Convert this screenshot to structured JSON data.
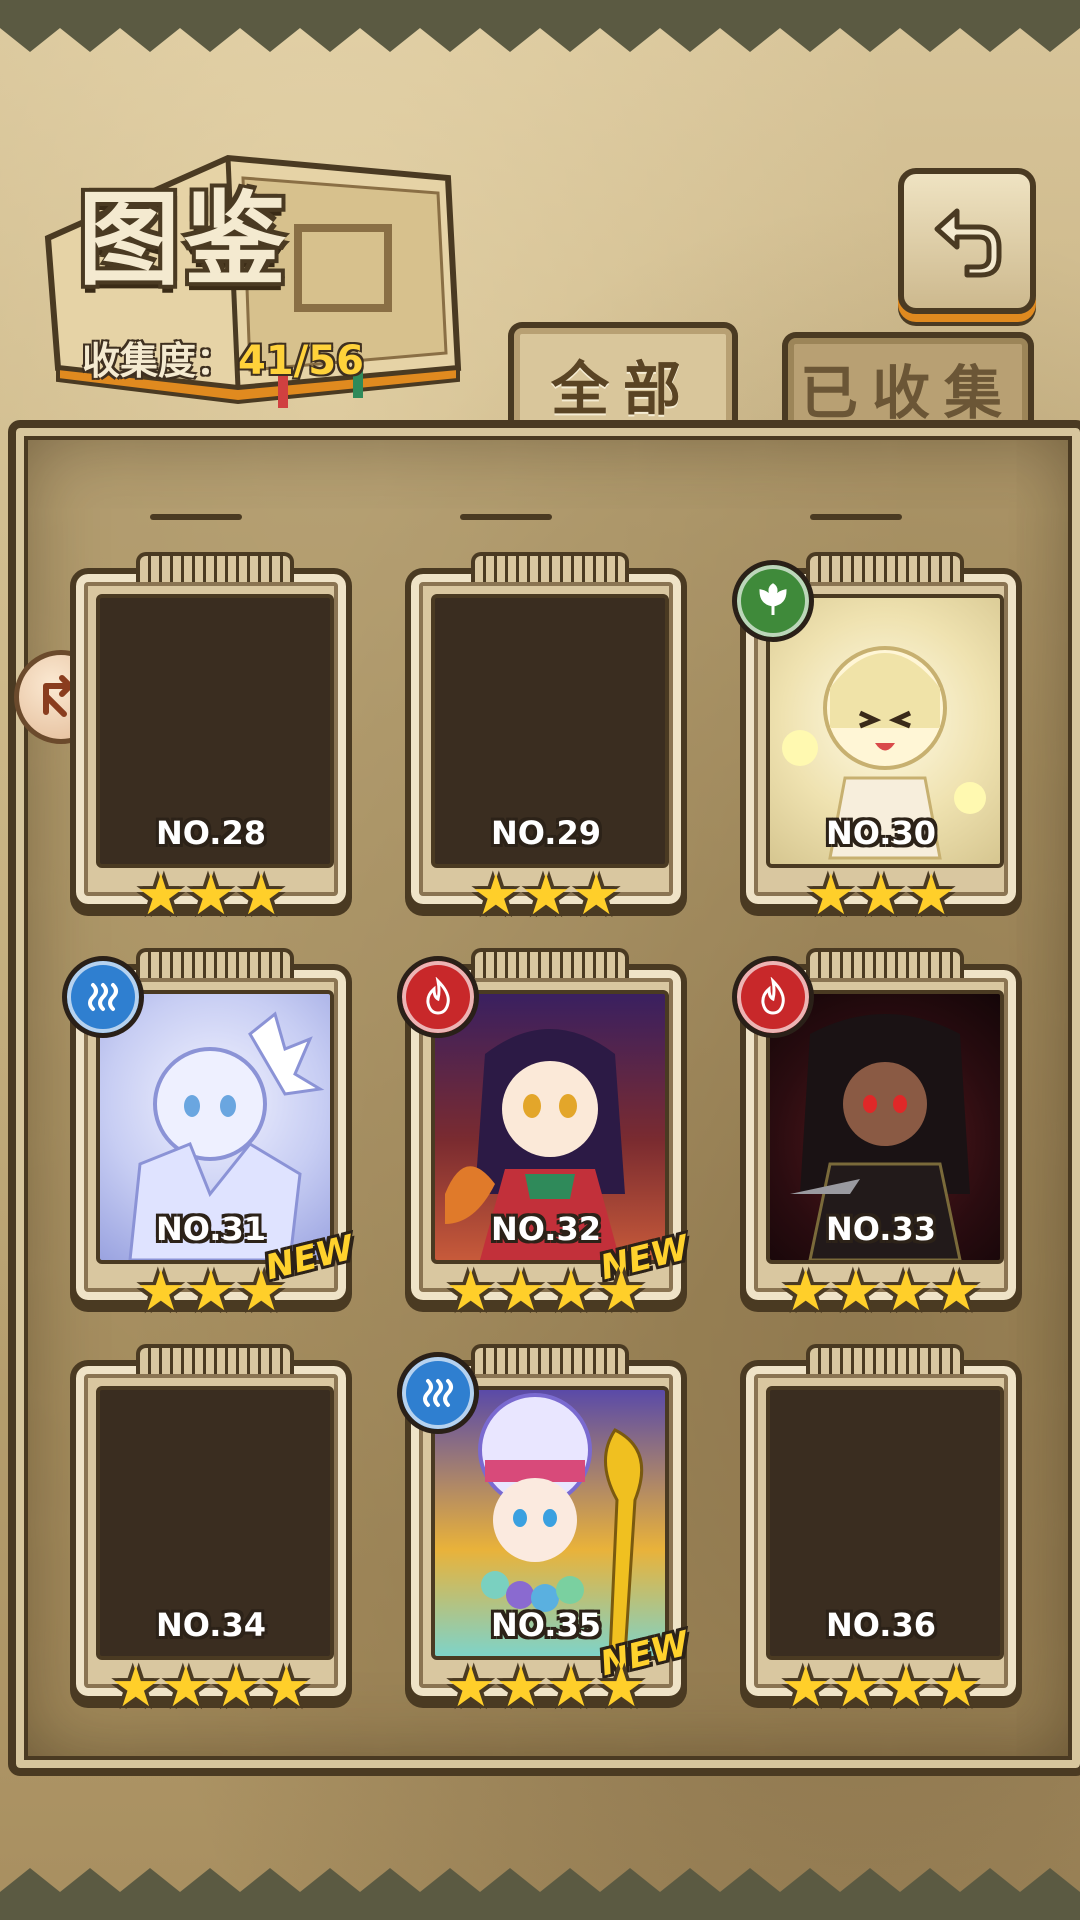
{
  "header": {
    "title": "图鉴",
    "progress_label": "收集度：",
    "progress_value": "41/56"
  },
  "tabs": [
    {
      "label": "全部",
      "active": true
    },
    {
      "label": "已收集",
      "active": false
    }
  ],
  "cards": [
    {
      "number": "NO.28",
      "stars": "★★★",
      "element": null,
      "unlocked": false,
      "new": false
    },
    {
      "number": "NO.29",
      "stars": "★★★",
      "element": null,
      "unlocked": false,
      "new": false
    },
    {
      "number": "NO.30",
      "stars": "★★★",
      "element": "leaf-icon",
      "unlocked": true,
      "new": false
    },
    {
      "number": "NO.31",
      "stars": "★★★",
      "element": "water-icon",
      "unlocked": true,
      "new": true
    },
    {
      "number": "NO.32",
      "stars": "★★★★",
      "element": "fire-icon",
      "unlocked": true,
      "new": true
    },
    {
      "number": "NO.33",
      "stars": "★★★★",
      "element": "fire-icon",
      "unlocked": true,
      "new": false
    },
    {
      "number": "NO.34",
      "stars": "★★★★",
      "element": null,
      "unlocked": false,
      "new": false
    },
    {
      "number": "NO.35",
      "stars": "★★★★",
      "element": "water-icon",
      "unlocked": true,
      "new": true
    },
    {
      "number": "NO.36",
      "stars": "★★★★",
      "element": null,
      "unlocked": false,
      "new": false
    }
  ],
  "new_label": "NEW",
  "colors": {
    "frame": "#4a3a22",
    "star": "#ffcf2a",
    "fire": "#c8282a",
    "water": "#2f7fd0",
    "wind": "#3f8a3a",
    "highlight": "#ffd23a"
  }
}
